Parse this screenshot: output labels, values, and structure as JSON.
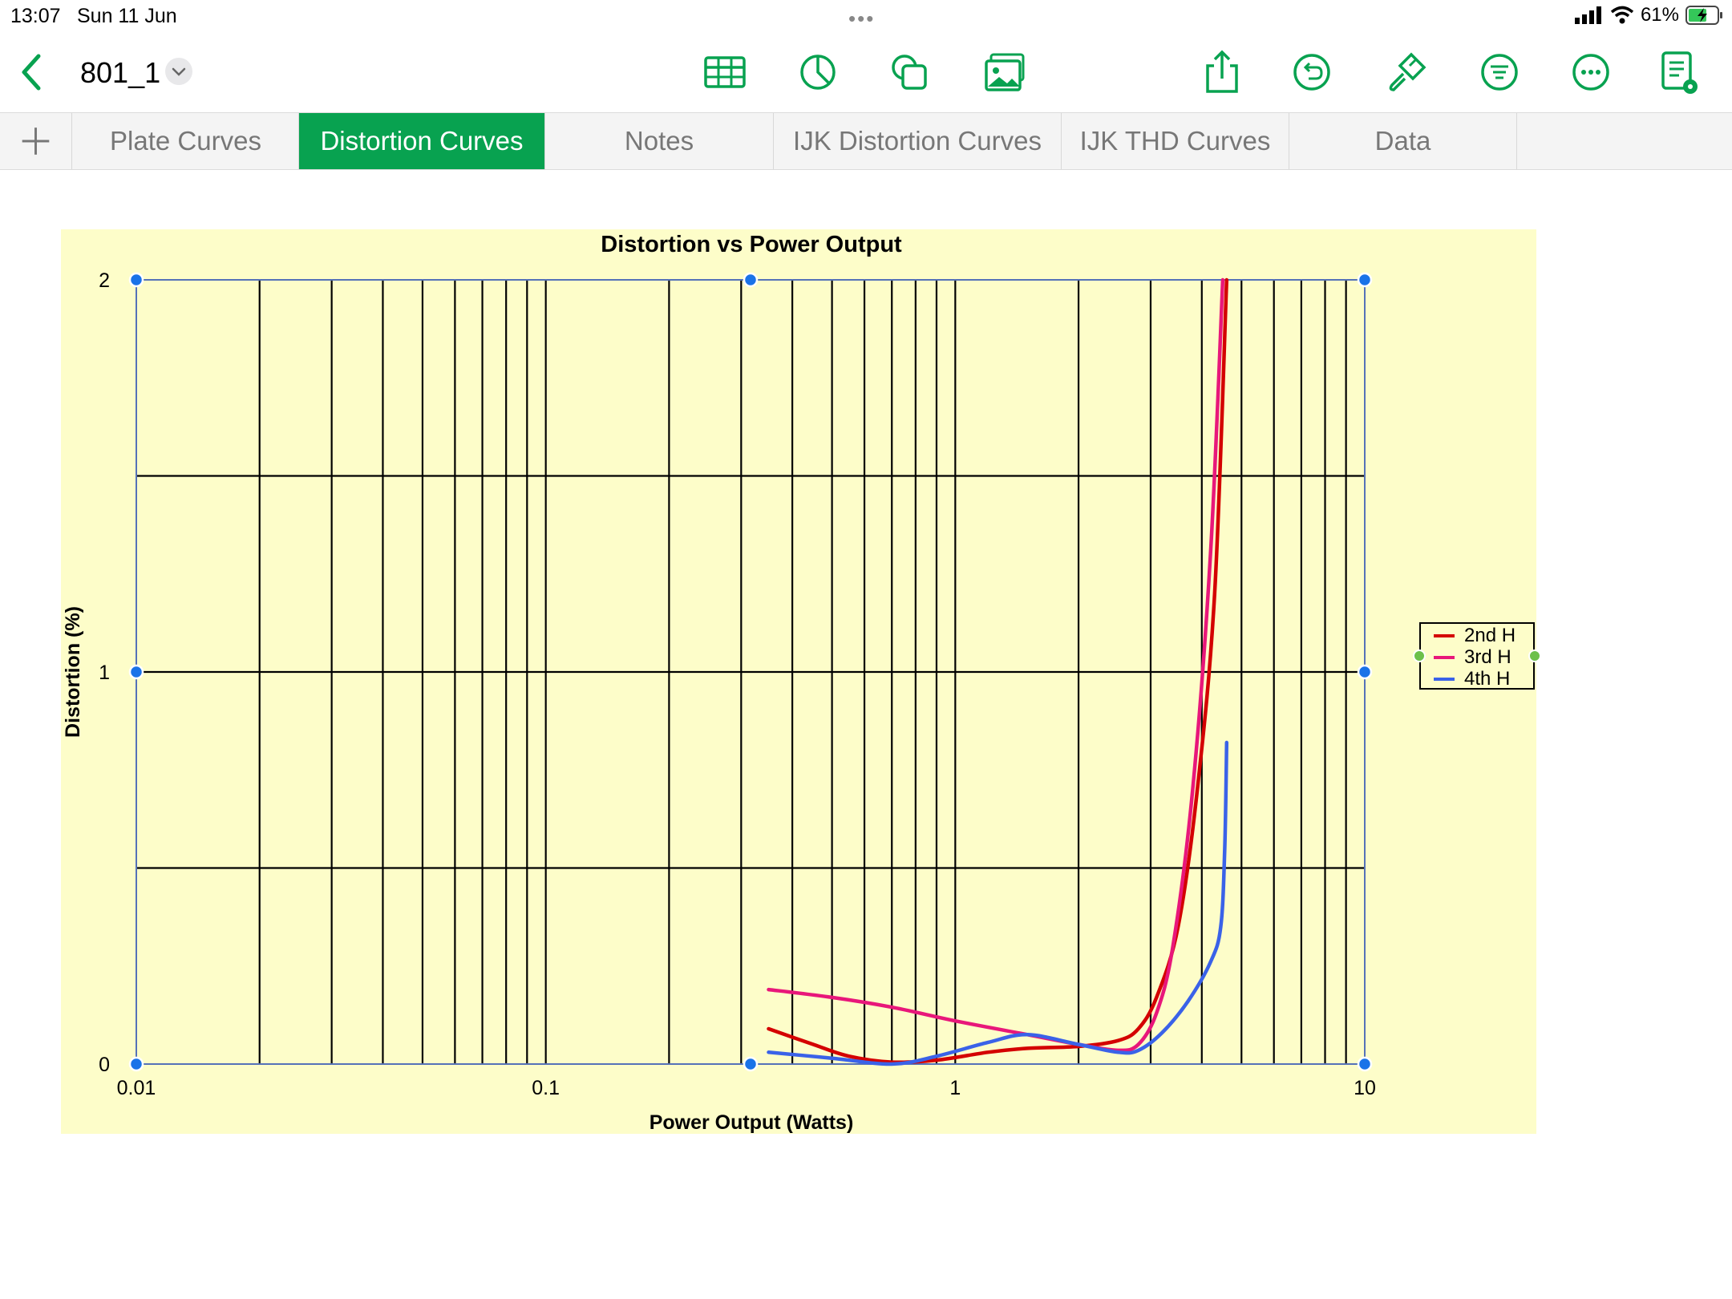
{
  "status_bar": {
    "time": "13:07",
    "date": "Sun 11 Jun",
    "battery": "61%"
  },
  "toolbar": {
    "title": "801_1",
    "icons": [
      "back-icon",
      "chevron-down-icon",
      "table-icon",
      "chart-icon",
      "shapes-icon",
      "media-icon",
      "share-icon",
      "undo-icon",
      "format-brush-icon",
      "organize-icon",
      "more-icon",
      "document-view-icon"
    ]
  },
  "tabs": [
    {
      "label": "Plate Curves",
      "active": false
    },
    {
      "label": "Distortion Curves",
      "active": true
    },
    {
      "label": "Notes",
      "active": false
    },
    {
      "label": "IJK Distortion Curves",
      "active": false
    },
    {
      "label": "IJK THD Curves",
      "active": false
    },
    {
      "label": "Data",
      "active": false
    }
  ],
  "chart_data": {
    "type": "line",
    "title": "Distortion vs Power Output",
    "xlabel": "Power Output (Watts)",
    "ylabel": "Distortion (%)",
    "x_scale": "log",
    "xlim": [
      0.01,
      10
    ],
    "ylim": [
      0,
      2
    ],
    "x_ticks": [
      "0.01",
      "0.1",
      "1",
      "10"
    ],
    "y_ticks": [
      "0",
      "1",
      "2"
    ],
    "grid": true,
    "background": "#fdfdc9",
    "legend_position": "right",
    "series": [
      {
        "name": "2nd H",
        "color": "#d40000",
        "x": [
          0.35,
          0.45,
          0.55,
          0.7,
          0.9,
          1.2,
          1.5,
          2.0,
          2.5,
          2.8,
          3.1,
          3.5,
          3.9,
          4.3,
          4.6
        ],
        "y": [
          0.09,
          0.05,
          0.02,
          0.005,
          0.01,
          0.03,
          0.04,
          0.045,
          0.06,
          0.09,
          0.17,
          0.35,
          0.7,
          1.2,
          2.0
        ]
      },
      {
        "name": "3rd H",
        "color": "#e8177a",
        "x": [
          0.35,
          0.5,
          0.7,
          1.0,
          1.5,
          2.0,
          2.5,
          2.8,
          3.1,
          3.4,
          3.8,
          4.2,
          4.5
        ],
        "y": [
          0.19,
          0.17,
          0.145,
          0.11,
          0.075,
          0.05,
          0.035,
          0.05,
          0.13,
          0.3,
          0.7,
          1.3,
          2.0
        ]
      },
      {
        "name": "4th H",
        "color": "#3a62e8",
        "x": [
          0.35,
          0.5,
          0.7,
          0.9,
          1.2,
          1.5,
          2.0,
          2.5,
          2.8,
          3.2,
          3.7,
          4.2,
          4.45,
          4.55,
          4.6
        ],
        "y": [
          0.03,
          0.015,
          0.0,
          0.02,
          0.055,
          0.075,
          0.05,
          0.03,
          0.035,
          0.08,
          0.16,
          0.26,
          0.35,
          0.55,
          0.82
        ]
      }
    ]
  }
}
